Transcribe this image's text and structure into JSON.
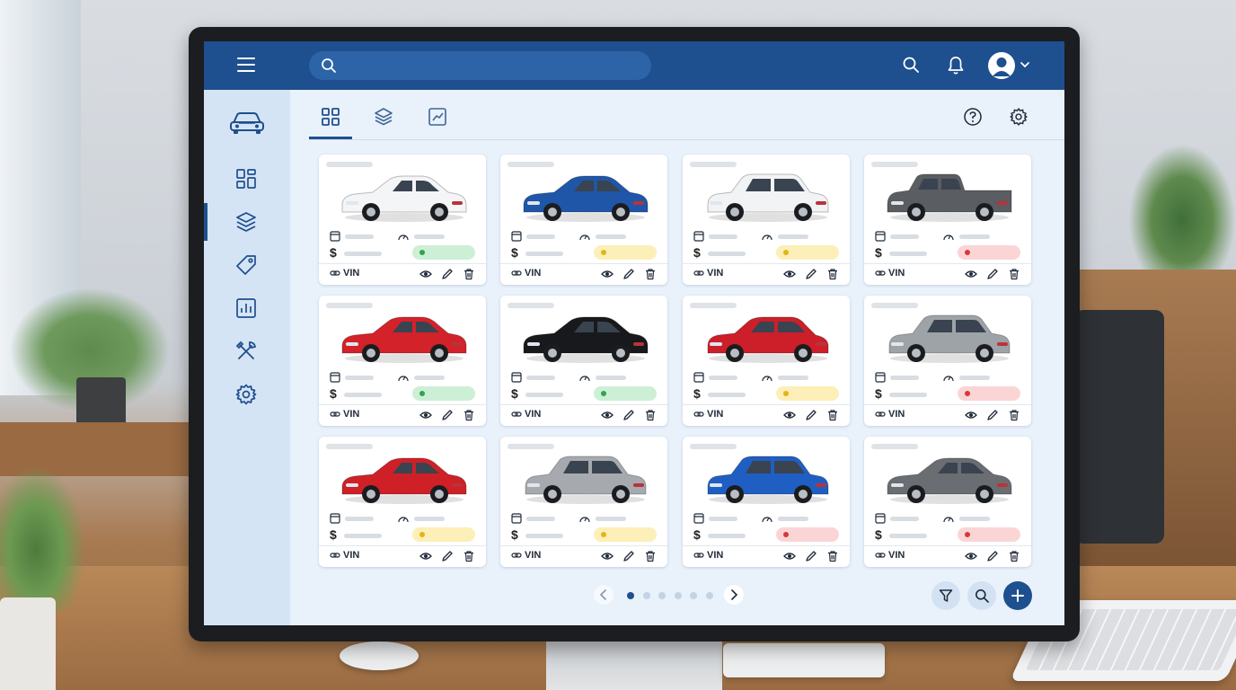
{
  "topbar": {
    "search": {
      "value": "",
      "placeholder": ""
    },
    "icons": [
      "menu-icon",
      "search-icon",
      "bell-icon",
      "user-icon",
      "chevron-down-icon"
    ]
  },
  "sidebar": {
    "items": [
      {
        "icon": "car-icon",
        "active": false
      },
      {
        "icon": "grid-icon",
        "active": false
      },
      {
        "icon": "layers-icon",
        "active": true
      },
      {
        "icon": "tag-icon",
        "active": false
      },
      {
        "icon": "bar-chart-icon",
        "active": false
      },
      {
        "icon": "tools-icon",
        "active": false
      },
      {
        "icon": "gear-icon",
        "active": false
      }
    ]
  },
  "tabs": {
    "items": [
      {
        "icon": "grid-icon",
        "active": true
      },
      {
        "icon": "layers-icon",
        "active": false
      },
      {
        "icon": "trend-chart-icon",
        "active": false
      }
    ],
    "right_icons": [
      "help-icon",
      "gear-icon"
    ]
  },
  "cards": [
    {
      "car_color": "#f4f5f6",
      "body": "sedan",
      "status": "green",
      "currency": "$",
      "vin_label": "VIN"
    },
    {
      "car_color": "#1f56a8",
      "body": "sedan",
      "status": "yellow",
      "currency": "$",
      "vin_label": "VIN"
    },
    {
      "car_color": "#f2f3f4",
      "body": "suv",
      "status": "yellow",
      "currency": "$",
      "vin_label": "VIN"
    },
    {
      "car_color": "#5a5d61",
      "body": "truck",
      "status": "red",
      "currency": "$",
      "vin_label": "VIN"
    },
    {
      "car_color": "#d3222a",
      "body": "sedan",
      "status": "green",
      "currency": "$",
      "vin_label": "VIN"
    },
    {
      "car_color": "#17191c",
      "body": "sedan",
      "status": "green",
      "currency": "$",
      "vin_label": "VIN"
    },
    {
      "car_color": "#cc1f2a",
      "body": "hatch",
      "status": "yellow",
      "currency": "$",
      "vin_label": "VIN"
    },
    {
      "car_color": "#9ea3a8",
      "body": "suv",
      "status": "red",
      "currency": "$",
      "vin_label": "VIN"
    },
    {
      "car_color": "#cf2027",
      "body": "sedan",
      "status": "yellow",
      "currency": "$",
      "vin_label": "VIN"
    },
    {
      "car_color": "#a6aaae",
      "body": "suv",
      "status": "yellow",
      "currency": "$",
      "vin_label": "VIN"
    },
    {
      "car_color": "#1f5fc4",
      "body": "suv",
      "status": "red",
      "currency": "$",
      "vin_label": "VIN"
    },
    {
      "car_color": "#6a6d71",
      "body": "sedan",
      "status": "red",
      "currency": "$",
      "vin_label": "VIN"
    }
  ],
  "status_colors": {
    "green": {
      "bg": "#cdefd6",
      "dot": "#2ea44f"
    },
    "yellow": {
      "bg": "#fcefb8",
      "dot": "#e3b418"
    },
    "red": {
      "bg": "#fbd5d6",
      "dot": "#d9363e"
    }
  },
  "card_actions": [
    "eye-icon",
    "pencil-icon",
    "trash-icon"
  ],
  "pagination": {
    "pages": 6,
    "current": 1
  },
  "fabs": [
    "filter-icon",
    "search-icon",
    "plus-icon"
  ],
  "colors": {
    "brand": "#1e4f8f",
    "sidebar": "#d5e4f4",
    "content": "#e9f1fb"
  }
}
